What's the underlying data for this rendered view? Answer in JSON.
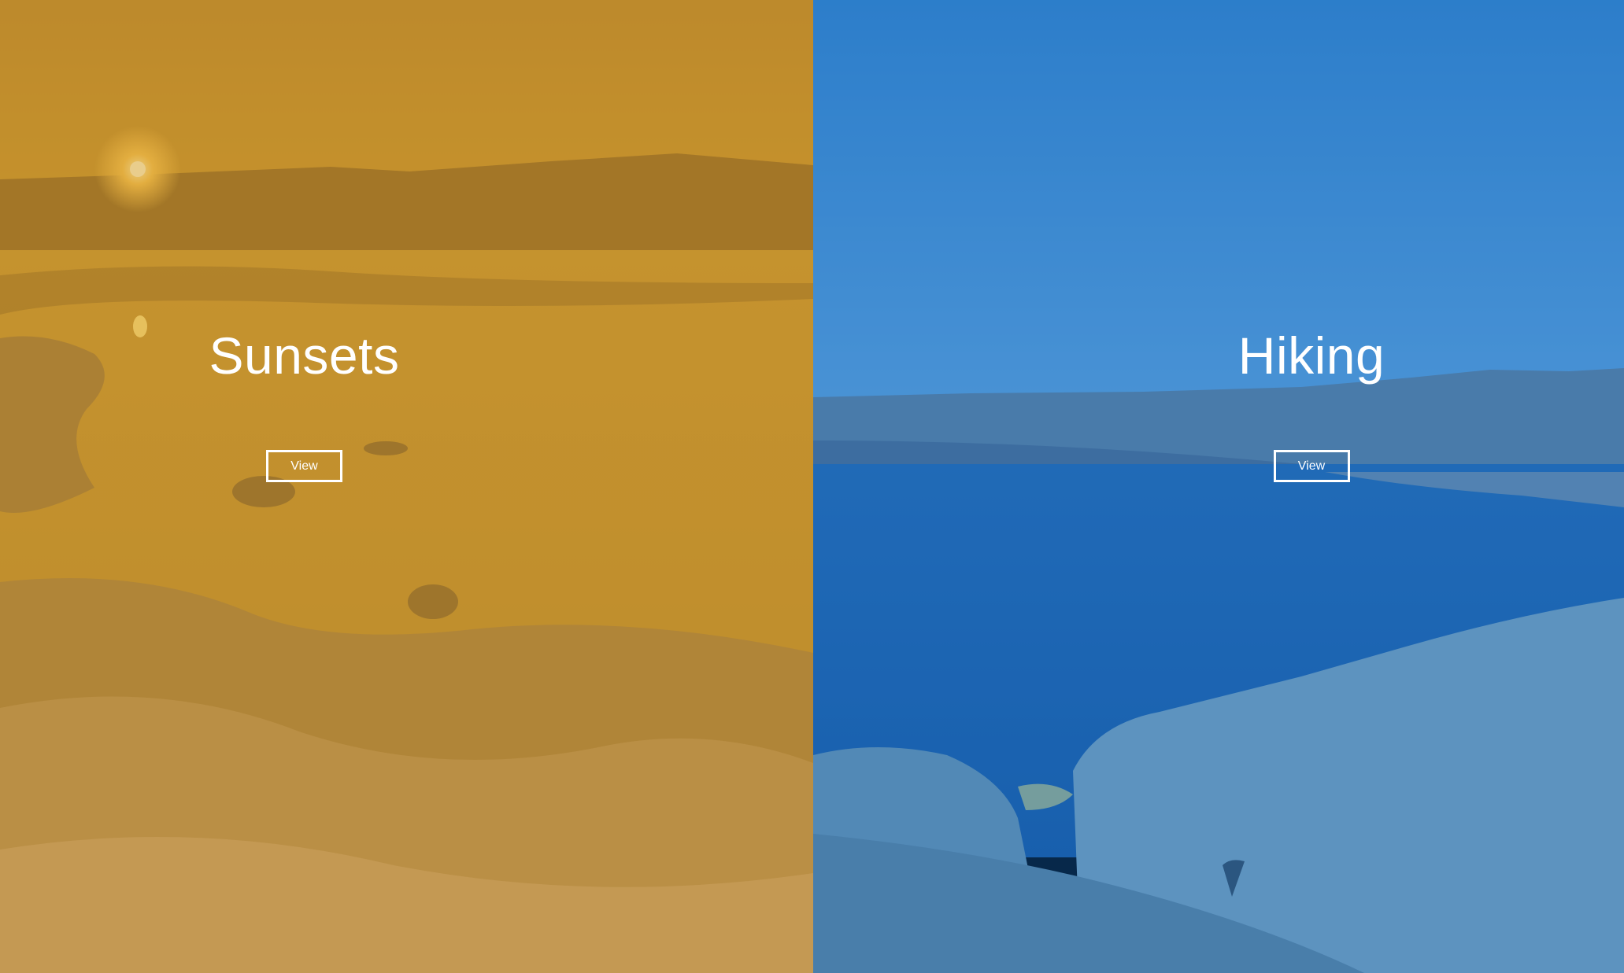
{
  "panels": [
    {
      "title": "Sunsets",
      "button_label": "View",
      "overlay_color": "#C68C14"
    },
    {
      "title": "Hiking",
      "button_label": "View",
      "overlay_color": "#1264B9"
    }
  ]
}
